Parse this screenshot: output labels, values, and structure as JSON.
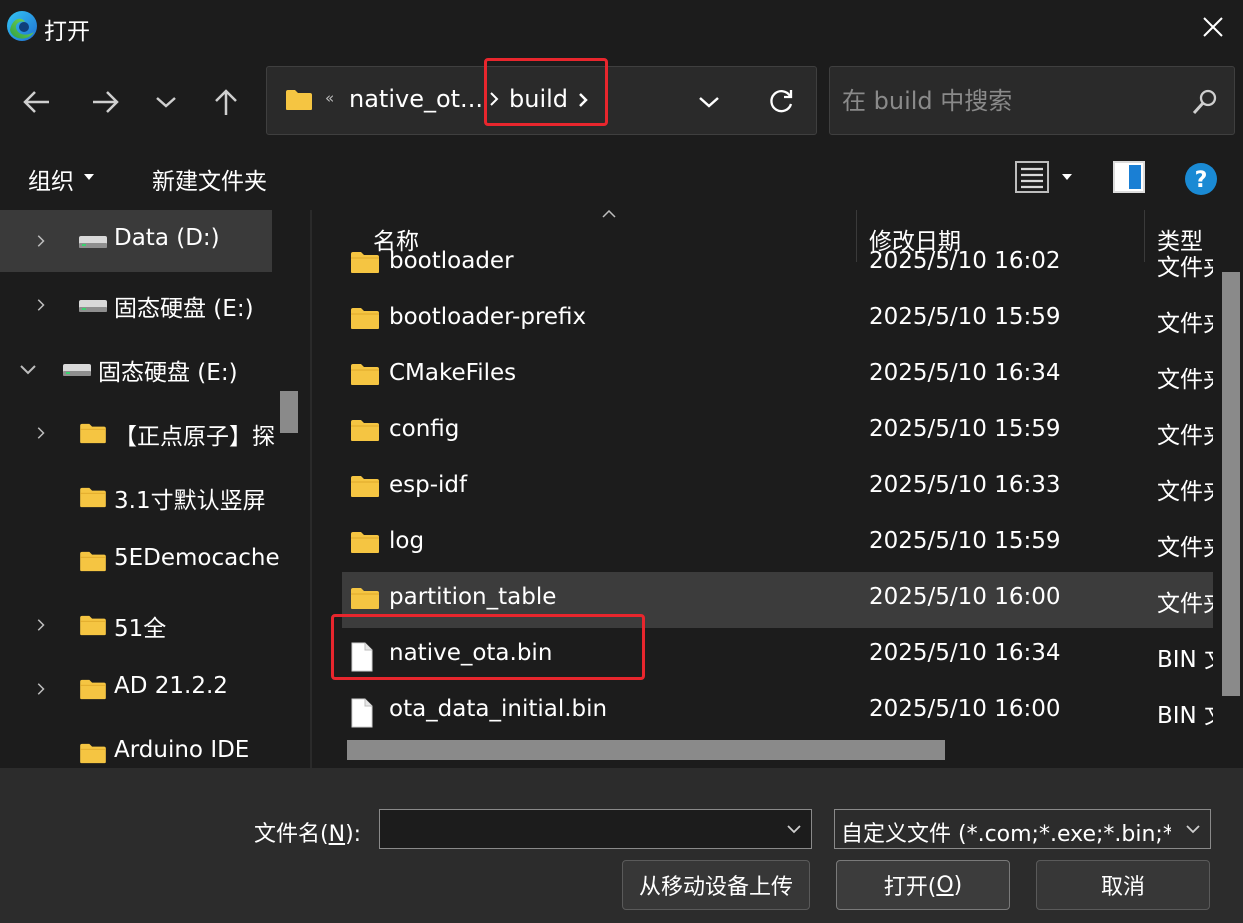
{
  "window": {
    "title": "打开",
    "app_icon": "edge-icon",
    "close_icon": "close-icon"
  },
  "nav": {
    "back_icon": "back-arrow-icon",
    "forward_icon": "forward-arrow-icon",
    "recent_icon": "chevron-down-icon",
    "up_icon": "up-arrow-icon"
  },
  "address": {
    "overflow": "«",
    "crumbs": [
      "native_ot...",
      "build"
    ],
    "dropdown_icon": "chevron-down-icon",
    "refresh_icon": "refresh-icon"
  },
  "search": {
    "placeholder": "在 build 中搜索",
    "value": ""
  },
  "toolbar": {
    "organize": "组织",
    "new_folder": "新建文件夹",
    "view_icon": "list-view-icon",
    "preview_icon": "preview-pane-icon",
    "help_icon": "help-icon"
  },
  "sidebar": {
    "items": [
      {
        "label": "Data (D:)",
        "icon": "drive-icon",
        "expandable": true,
        "expanded": false,
        "level": 1,
        "selected": true
      },
      {
        "label": "固态硬盘 (E:)",
        "icon": "drive-icon",
        "expandable": true,
        "expanded": false,
        "level": 1,
        "selected": false
      },
      {
        "label": "固态硬盘 (E:)",
        "icon": "drive-icon",
        "expandable": true,
        "expanded": true,
        "level": 0,
        "selected": false
      },
      {
        "label": "【正点原子】探",
        "icon": "folder-icon",
        "expandable": true,
        "expanded": false,
        "level": 1,
        "selected": false
      },
      {
        "label": "3.1寸默认竖屏",
        "icon": "folder-icon",
        "expandable": false,
        "expanded": false,
        "level": 1,
        "selected": false
      },
      {
        "label": "5EDemocache",
        "icon": "folder-icon",
        "expandable": false,
        "expanded": false,
        "level": 1,
        "selected": false
      },
      {
        "label": "51全",
        "icon": "folder-icon",
        "expandable": true,
        "expanded": false,
        "level": 1,
        "selected": false
      },
      {
        "label": "AD 21.2.2",
        "icon": "folder-icon",
        "expandable": true,
        "expanded": false,
        "level": 1,
        "selected": false
      },
      {
        "label": "Arduino IDE",
        "icon": "folder-icon",
        "expandable": false,
        "expanded": false,
        "level": 1,
        "selected": false
      }
    ]
  },
  "file_list": {
    "columns": [
      "名称",
      "修改日期",
      "类型"
    ],
    "rows": [
      {
        "name": "bootloader",
        "date": "2025/5/10 16:02",
        "type": "文件夹",
        "icon": "folder-icon",
        "hover": false
      },
      {
        "name": "bootloader-prefix",
        "date": "2025/5/10 15:59",
        "type": "文件夹",
        "icon": "folder-icon",
        "hover": false
      },
      {
        "name": "CMakeFiles",
        "date": "2025/5/10 16:34",
        "type": "文件夹",
        "icon": "folder-icon",
        "hover": false
      },
      {
        "name": "config",
        "date": "2025/5/10 15:59",
        "type": "文件夹",
        "icon": "folder-icon",
        "hover": false
      },
      {
        "name": "esp-idf",
        "date": "2025/5/10 16:33",
        "type": "文件夹",
        "icon": "folder-icon",
        "hover": false
      },
      {
        "name": "log",
        "date": "2025/5/10 15:59",
        "type": "文件夹",
        "icon": "folder-icon",
        "hover": false
      },
      {
        "name": "partition_table",
        "date": "2025/5/10 16:00",
        "type": "文件夹",
        "icon": "folder-icon",
        "hover": true
      },
      {
        "name": "native_ota.bin",
        "date": "2025/5/10 16:34",
        "type": "BIN 文件",
        "icon": "file-icon",
        "hover": false
      },
      {
        "name": "ota_data_initial.bin",
        "date": "2025/5/10 16:00",
        "type": "BIN 文件",
        "icon": "file-icon",
        "hover": false
      }
    ]
  },
  "bottom": {
    "filename_label_prefix": "文件名(",
    "filename_label_key": "N",
    "filename_label_suffix": "):",
    "filename_value": "",
    "filter": "自定义文件 (*.com;*.exe;*.bin;*",
    "upload_button": "从移动设备上传",
    "open_prefix": "打开(",
    "open_key": "O",
    "open_suffix": ")",
    "cancel_button": "取消"
  },
  "colors": {
    "background": "#1c1c1c",
    "bottom_panel": "#2c2c2c",
    "folder": "#f5c542",
    "highlight_box": "#e8262d",
    "help_blue": "#1a8ad4"
  }
}
